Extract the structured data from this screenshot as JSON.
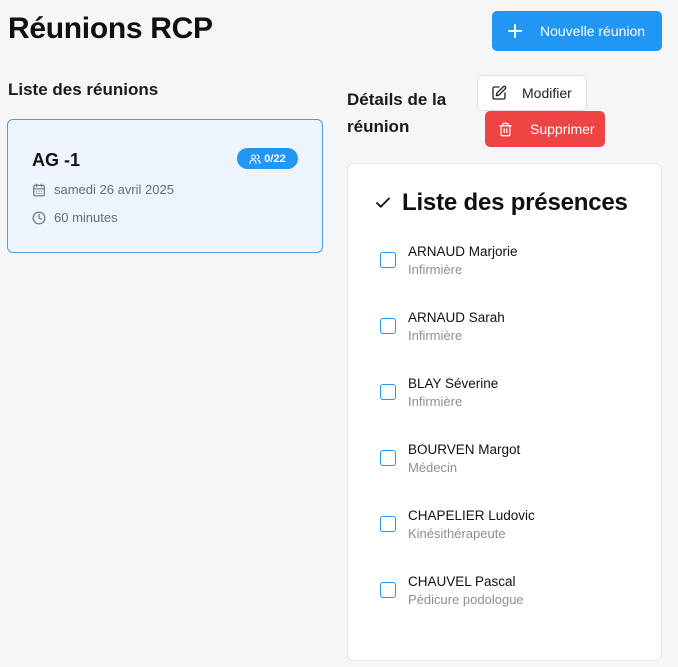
{
  "header": {
    "title": "Réunions RCP",
    "new_button_label": "Nouvelle réunion"
  },
  "list": {
    "heading": "Liste des réunions",
    "meetings": [
      {
        "name": "AG -1",
        "attendance_badge": "0/22",
        "date": "samedi 26 avril 2025",
        "duration": "60 minutes"
      }
    ]
  },
  "details": {
    "heading": "Détails de la réunion",
    "edit_label": "Modifier",
    "delete_label": "Supprimer",
    "presence": {
      "title": "Liste des présences",
      "people": [
        {
          "name": "ARNAUD Marjorie",
          "role": "Infirmière",
          "checked": false
        },
        {
          "name": "ARNAUD Sarah",
          "role": "Infirmière",
          "checked": false
        },
        {
          "name": "BLAY Séverine",
          "role": "Infirmière",
          "checked": false
        },
        {
          "name": "BOURVEN Margot",
          "role": "Médecin",
          "checked": false
        },
        {
          "name": "CHAPELIER Ludovic",
          "role": "Kinésithérapeute",
          "checked": false
        },
        {
          "name": "CHAUVEL Pascal",
          "role": "Pédicure podologue",
          "checked": false
        }
      ]
    }
  },
  "colors": {
    "primary": "#2196f3",
    "danger": "#ef4444",
    "card_bg": "#eef4fb",
    "page_bg": "#f5f6f8"
  }
}
